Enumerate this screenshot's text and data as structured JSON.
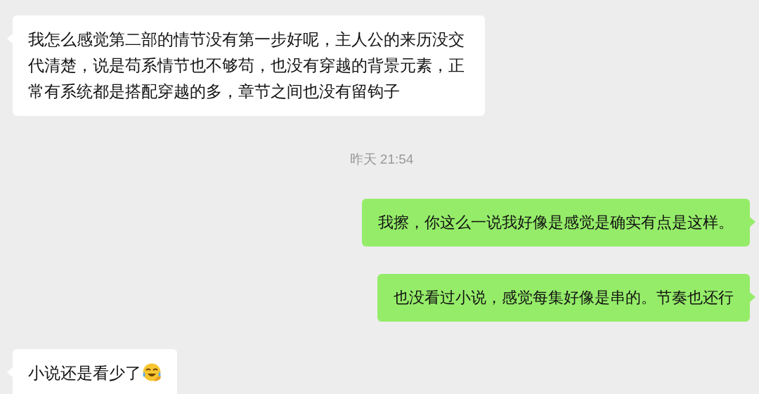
{
  "messages": [
    {
      "kind": "received",
      "text": "我怎么感觉第二部的情节没有第一步好呢，主人公的来历没交代清楚，说是苟系情节也不够苟，也没有穿越的背景元素，正常有系统都是搭配穿越的多，章节之间也没有留钩子",
      "emoji": false
    },
    {
      "kind": "time",
      "text": "昨天 21:54"
    },
    {
      "kind": "sent",
      "text": "我擦，你这么一说我好像是感觉是确实有点是这样。"
    },
    {
      "kind": "sent",
      "text": "也没看过小说，感觉每集好像是串的。节奏也还行"
    },
    {
      "kind": "received",
      "text": "小说还是看少了",
      "emoji": true
    }
  ]
}
